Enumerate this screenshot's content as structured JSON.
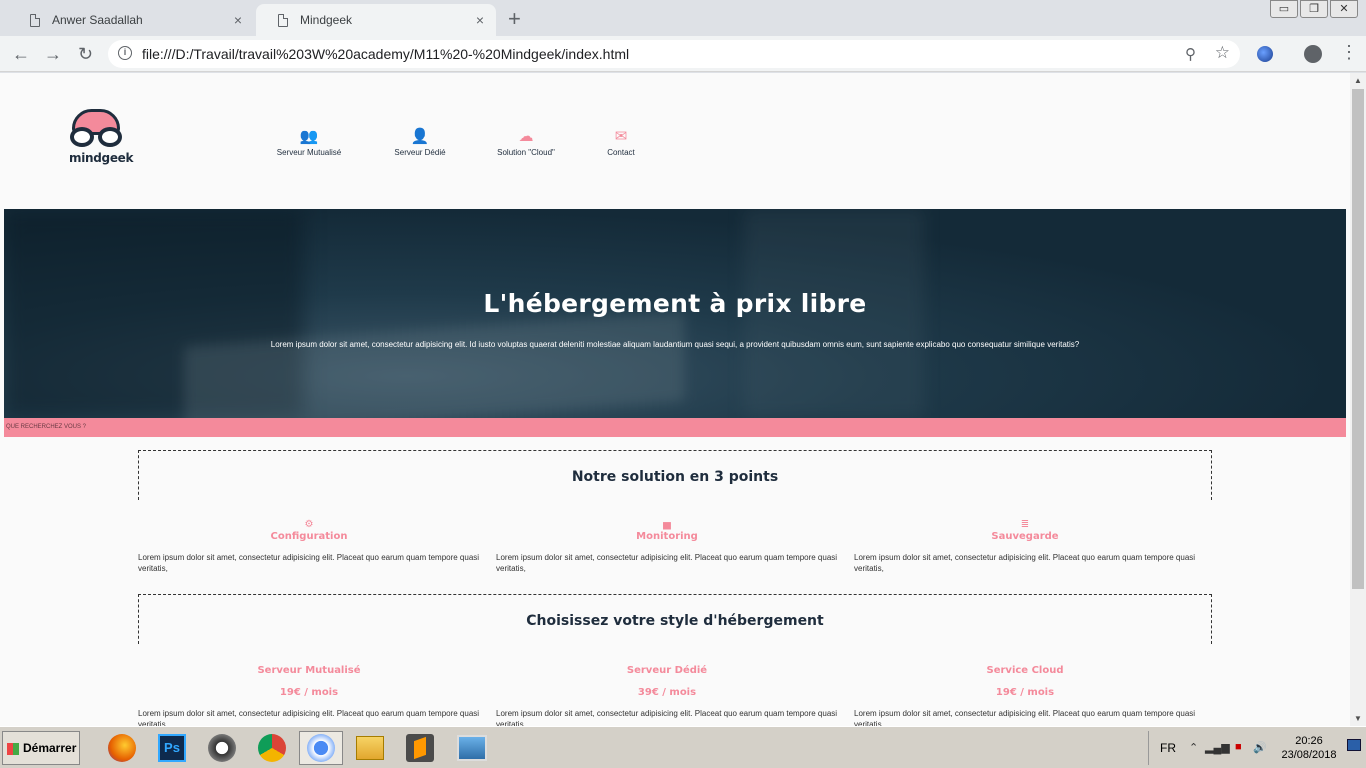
{
  "browser": {
    "tabs": [
      {
        "title": "Anwer Saadallah",
        "close": "×"
      },
      {
        "title": "Mindgeek",
        "close": "×"
      }
    ],
    "new_tab": "+",
    "window_buttons": [
      "▭",
      "❐",
      "✕"
    ],
    "nav": {
      "back": "←",
      "forward": "→",
      "reload": "↻"
    },
    "url": "file:///D:/Travail/travail%203W%20academy/M11%20-%20Mindgeek/index.html",
    "menu": "⋮"
  },
  "site": {
    "logo_text": "mindgeek",
    "menu": [
      {
        "label": "Serveur Mutualisé",
        "icon": "users-icon",
        "glyph": "👥"
      },
      {
        "label": "Serveur Dédié",
        "icon": "user-icon",
        "glyph": "👤"
      },
      {
        "label": "Solution \"Cloud\"",
        "icon": "cloud-icon",
        "glyph": "☁"
      },
      {
        "label": "Contact",
        "icon": "envelope-icon",
        "glyph": "✉"
      }
    ],
    "hero": {
      "title": "L'hébergement à prix libre",
      "text": "Lorem ipsum dolor sit amet, consectetur adipisicing elit. Id iusto voluptas quaerat deleniti molestiae aliquam laudantium quasi sequi, a provident quibusdam omnis eum, sunt sapiente explicabo quo consequatur similique veritatis?"
    },
    "search_label": "QUE RECHERCHEZ VOUS ?",
    "points": {
      "heading": "Notre solution en 3 points",
      "items": [
        {
          "title": "Configuration",
          "icon": "cogs-icon",
          "glyph": "⚙",
          "text": "Lorem ipsum dolor sit amet, consectetur adipisicing elit. Placeat quo earum quam tempore quasi veritatis,"
        },
        {
          "title": "Monitoring",
          "icon": "chart-icon",
          "glyph": "▅",
          "text": "Lorem ipsum dolor sit amet, consectetur adipisicing elit. Placeat quo earum quam tempore quasi veritatis,"
        },
        {
          "title": "Sauvegarde",
          "icon": "database-icon",
          "glyph": "≣",
          "text": "Lorem ipsum dolor sit amet, consectetur adipisicing elit. Placeat quo earum quam tempore quasi veritatis,"
        }
      ]
    },
    "styles": {
      "heading": "Choisissez votre style d'hébergement",
      "items": [
        {
          "title": "Serveur Mutualisé",
          "price": "19€ / mois",
          "text": "Lorem ipsum dolor sit amet, consectetur adipisicing elit. Placeat quo earum quam tempore quasi veritatis,"
        },
        {
          "title": "Serveur Dédié",
          "price": "39€ / mois",
          "text": "Lorem ipsum dolor sit amet, consectetur adipisicing elit. Placeat quo earum quam tempore quasi veritatis,"
        },
        {
          "title": "Service Cloud",
          "price": "19€ / mois",
          "text": "Lorem ipsum dolor sit amet, consectetur adipisicing elit. Placeat quo earum quam tempore quasi veritatis,"
        }
      ]
    }
  },
  "taskbar": {
    "start": "Démarrer",
    "apps": [
      "firefox-icon",
      "photoshop-icon",
      "inkscape-icon",
      "chrome-icon",
      "chrome-canary-icon",
      "explorer-icon",
      "sublime-icon",
      "image-viewer-icon"
    ],
    "ps_label": "Ps",
    "lang": "FR",
    "time": "20:26",
    "date": "23/08/2018"
  },
  "colors": {
    "accent": "#f48a9b",
    "dark": "#1f2d3d",
    "hero": "#1a3142"
  }
}
